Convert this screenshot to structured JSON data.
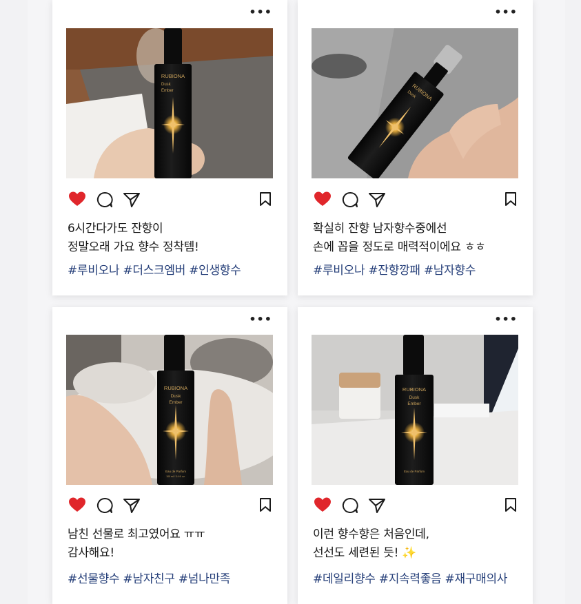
{
  "posts": [
    {
      "caption_line1": "6시간다가도 잔향이",
      "caption_line2": "정말오래 가요 향수 정착템!",
      "hashtags": "#루비오나 #더스크엠버 #인생향수",
      "liked": true
    },
    {
      "caption_line1": "확실히 잔향 남자향수중에선",
      "caption_line2": "손에 꼽을 정도로 매력적이에요 ㅎㅎ",
      "hashtags": "#루비오나 #잔향깡패 #남자향수",
      "liked": true
    },
    {
      "caption_line1": "남친 선물로 최고였어요 ㅠㅠ",
      "caption_line2": "감사해요!",
      "hashtags": "#선물향수 #남자친구 #넘나만족",
      "liked": true
    },
    {
      "caption_line1": "이런 향수향은 처음인데,",
      "caption_line2": "선선도 세련된 듯! ✨",
      "hashtags": "#데일리향수 #지속력좋음 #재구매의사",
      "liked": true
    }
  ],
  "product": {
    "brand": "RUBIONA",
    "name_line1": "Dusk",
    "name_line2": "Ember",
    "type": "Eau de Parfum",
    "volume": "100 ml / 3.4 fl. oz."
  },
  "icons": {
    "more": "more-horizontal-icon",
    "like": "heart-icon",
    "comment": "comment-icon",
    "share": "send-icon",
    "save": "bookmark-icon"
  },
  "colors": {
    "heart": "#e0262b",
    "hashtag": "#27407a",
    "bottle": "#111111",
    "label_gold": "#c9a15a"
  }
}
